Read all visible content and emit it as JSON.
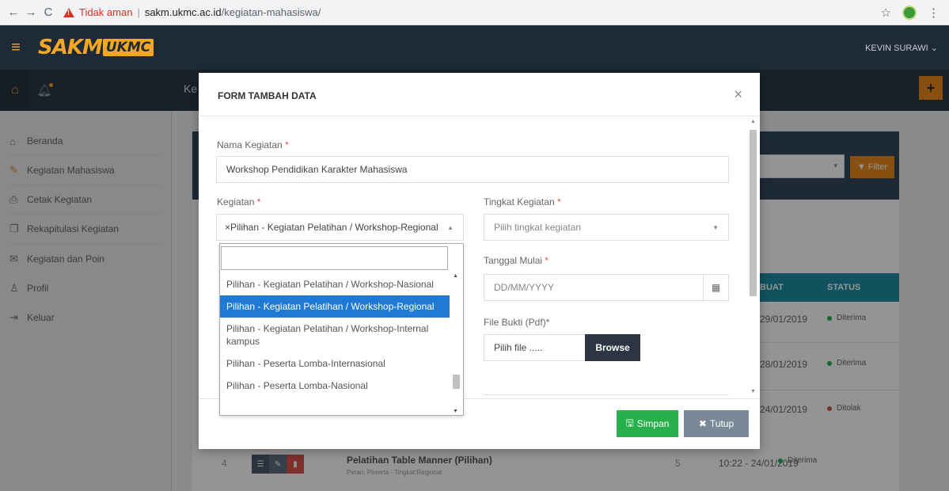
{
  "browser": {
    "back": "←",
    "forward": "→",
    "reload": "C",
    "security_label": "Tidak aman",
    "url_host": "sakm.ukmc.ac.id",
    "url_path": "/kegiatan-mahasiswa/",
    "star": "☆",
    "menu": "⋮"
  },
  "topbar": {
    "hamburger": "≡",
    "logo_main": "SAKM",
    "logo_sub": "UKMC",
    "user": "KEVIN SURAWI ⌄"
  },
  "subbar": {
    "home_icon": "⌂",
    "bell_icon": "♫",
    "title_fragment": "Ke",
    "add": "+"
  },
  "sidebar": {
    "items": [
      {
        "label": "Beranda",
        "icon": "⌂"
      },
      {
        "label": "Kegiatan Mahasiswa",
        "icon": "✎"
      },
      {
        "label": "Cetak Kegiatan",
        "icon": "⎙"
      },
      {
        "label": "Rekapitulasi Kegiatan",
        "icon": "❐"
      },
      {
        "label": "Kegiatan dan Poin",
        "icon": "✉"
      },
      {
        "label": "Profil",
        "icon": "♙"
      },
      {
        "label": "Keluar",
        "icon": "⇥"
      }
    ]
  },
  "background": {
    "filter_label": "Filter",
    "filter_caret": "▾",
    "col_buat": "BUAT",
    "col_status": "STATUS",
    "rows": [
      {
        "date": "29/01/2019",
        "status": "Diterima",
        "color": "#27b04b"
      },
      {
        "date": "28/01/2019",
        "status": "Diterima",
        "color": "#27b04b"
      },
      {
        "date": "24/01/2019",
        "status": "Ditolak",
        "color": "#d9534f"
      }
    ],
    "row4": {
      "num": "4",
      "title": "Pelatihan Table Manner (Pilihan)",
      "sub": "Peran: Peserta - Tingkat:Regional",
      "poin": "5",
      "date": "10:22 - 24/01/2019",
      "status": "Diterima",
      "status_color": "#27b04b"
    }
  },
  "modal": {
    "title": "FORM TAMBAH DATA",
    "close": "×",
    "nama_label": "Nama Kegiatan",
    "nama_value": "Workshop Pendidikan Karakter Mahasiswa",
    "kegiatan_label": "Kegiatan",
    "kegiatan_value": "×Pilihan - Kegiatan Pelatihan / Workshop-Regional",
    "tingkat_label": "Tingkat Kegiatan",
    "tingkat_placeholder": "Pilih tingkat kegiatan",
    "tanggal_label": "Tanggal Mulai",
    "tanggal_placeholder": "DD/MM/YYYY",
    "file_label": "File Bukti (Pdf)*",
    "file_placeholder": "Pilih file .....",
    "browse": "Browse",
    "required_mark": "*",
    "save": "Simpan",
    "close_btn": "Tutup"
  },
  "dropdown": {
    "options": [
      "Pilihan - Kegiatan Pelatihan / Workshop-Nasional",
      "Pilihan - Kegiatan Pelatihan / Workshop-Regional",
      "Pilihan - Kegiatan Pelatihan / Workshop-Internal kampus",
      "Pilihan - Peserta Lomba-Internasional",
      "Pilihan - Peserta Lomba-Nasional"
    ],
    "selected_index": 1
  },
  "colors": {
    "accent": "#f5a623",
    "primary_dark": "#1e2a38",
    "selected": "#1f7ad6",
    "success": "#27b04b",
    "danger": "#d9534f"
  }
}
